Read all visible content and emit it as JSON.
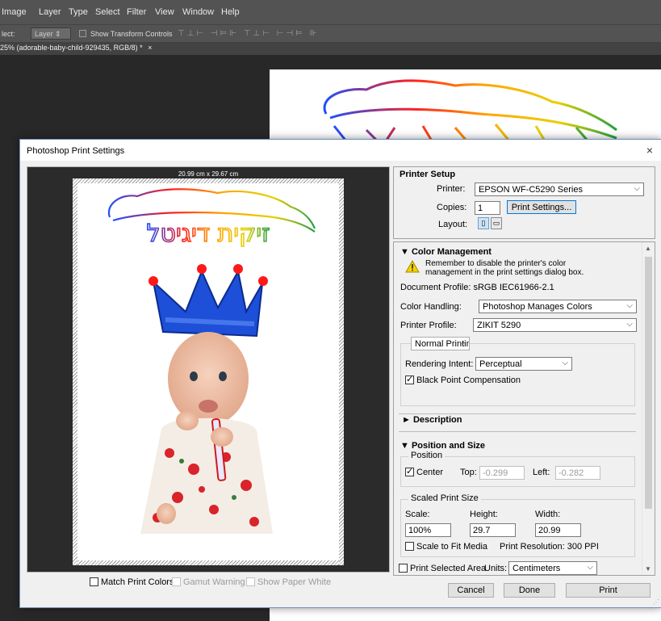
{
  "photoshop": {
    "menu": [
      "Image",
      "Layer",
      "Type",
      "Select",
      "Filter",
      "View",
      "Window",
      "Help"
    ],
    "options_bar": {
      "select_label": "lect:",
      "select_value": "Layer",
      "show_transform_controls": "Show Transform Controls"
    },
    "doc_tab": "25% (adorable-baby-child-929435, RGB/8) *",
    "doc_tab_close": "×"
  },
  "dialog": {
    "title": "Photoshop Print Settings",
    "close": "×",
    "preview": {
      "dimensions": "20.99 cm x 29.67 cm"
    },
    "bottom_checks": {
      "match_print_colors": "Match Print Colors",
      "gamut_warning": "Gamut Warning",
      "show_paper_white": "Show Paper White"
    },
    "printer_setup": {
      "heading": "Printer Setup",
      "printer_label": "Printer:",
      "printer_value": "EPSON WF-C5290 Series",
      "copies_label": "Copies:",
      "copies_value": "1",
      "print_settings_button": "Print Settings...",
      "layout_label": "Layout:"
    },
    "color_management": {
      "heading": "Color Management",
      "warning": "Remember to disable the printer's color management in the print settings dialog box.",
      "document_profile": "Document Profile: sRGB IEC61966-2.1",
      "color_handling_label": "Color Handling:",
      "color_handling_value": "Photoshop Manages Colors",
      "printer_profile_label": "Printer Profile:",
      "printer_profile_value": "ZIKIT 5290",
      "normal_printing": "Normal Printing",
      "rendering_intent_label": "Rendering Intent:",
      "rendering_intent_value": "Perceptual",
      "black_point_compensation": "Black Point Compensation"
    },
    "description": {
      "heading": "Description"
    },
    "position_size": {
      "heading": "Position and Size",
      "position_legend": "Position",
      "center_label": "Center",
      "top_label": "Top:",
      "top_value": "-0.299",
      "left_label": "Left:",
      "left_value": "-0.282",
      "scaled_legend": "Scaled Print Size",
      "scale_label": "Scale:",
      "scale_value": "100%",
      "height_label": "Height:",
      "height_value": "29.7",
      "width_label": "Width:",
      "width_value": "20.99",
      "scale_to_fit": "Scale to Fit Media",
      "print_resolution": "Print Resolution: 300 PPI",
      "print_selected_area": "Print Selected Area",
      "units_label": "Units:",
      "units_value": "Centimeters"
    },
    "footer": {
      "cancel": "Cancel",
      "done": "Done",
      "print": "Print"
    }
  },
  "artwork": {
    "headline_text": "זיקית דיגיטל"
  }
}
